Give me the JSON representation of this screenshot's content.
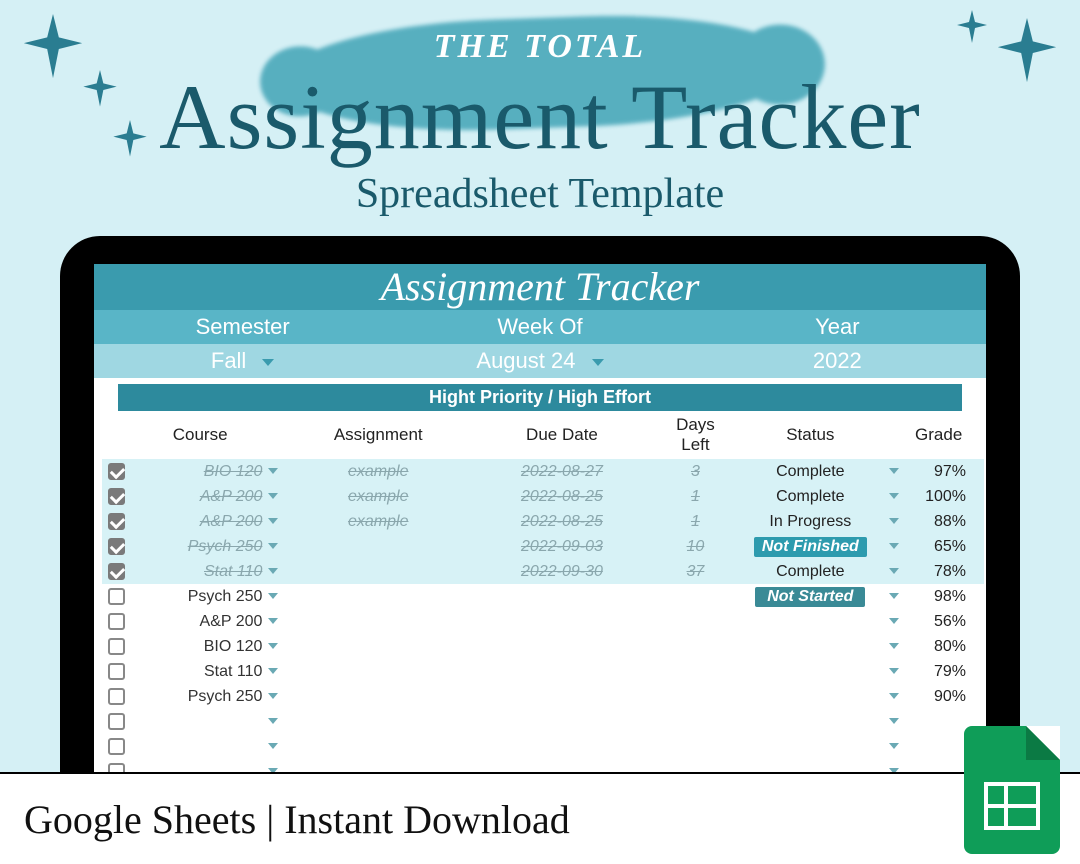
{
  "hero": {
    "eyebrow": "THE TOTAL",
    "title": "Assignment Tracker",
    "subtitle": "Spreadsheet Template"
  },
  "sheet": {
    "banner": "Assignment Tracker",
    "selectors": {
      "semester_label": "Semester",
      "semester_value": "Fall",
      "week_label": "Week Of",
      "week_value": "August 24",
      "year_label": "Year",
      "year_value": "2022"
    },
    "section_label": "Hight Priority / High Effort",
    "columns": {
      "course": "Course",
      "assignment": "Assignment",
      "due": "Due Date",
      "days": "Days Left",
      "status": "Status",
      "grade": "Grade"
    },
    "rows": [
      {
        "checked": true,
        "done": true,
        "course": "BIO 120",
        "assignment": "example",
        "due": "2022-08-27",
        "days": "3",
        "status": "Complete",
        "status_style": "plain",
        "grade": "97%"
      },
      {
        "checked": true,
        "done": true,
        "course": "A&P 200",
        "assignment": "example",
        "due": "2022-08-25",
        "days": "1",
        "status": "Complete",
        "status_style": "plain",
        "grade": "100%"
      },
      {
        "checked": true,
        "done": true,
        "course": "A&P 200",
        "assignment": "example",
        "due": "2022-08-25",
        "days": "1",
        "status": "In Progress",
        "status_style": "plain",
        "grade": "88%"
      },
      {
        "checked": true,
        "done": true,
        "course": "Psych 250",
        "assignment": "",
        "due": "2022-09-03",
        "days": "10",
        "status": "Not Finished",
        "status_style": "teal",
        "grade": "65%"
      },
      {
        "checked": true,
        "done": true,
        "course": "Stat 110",
        "assignment": "",
        "due": "2022-09-30",
        "days": "37",
        "status": "Complete",
        "status_style": "plain",
        "grade": "78%"
      },
      {
        "checked": false,
        "done": false,
        "course": "Psych 250",
        "assignment": "",
        "due": "",
        "days": "",
        "status": "Not Started",
        "status_style": "dark",
        "grade": "98%"
      },
      {
        "checked": false,
        "done": false,
        "course": "A&P 200",
        "assignment": "",
        "due": "",
        "days": "",
        "status": "",
        "status_style": "none",
        "grade": "56%"
      },
      {
        "checked": false,
        "done": false,
        "course": "BIO 120",
        "assignment": "",
        "due": "",
        "days": "",
        "status": "",
        "status_style": "none",
        "grade": "80%"
      },
      {
        "checked": false,
        "done": false,
        "course": "Stat 110",
        "assignment": "",
        "due": "",
        "days": "",
        "status": "",
        "status_style": "none",
        "grade": "79%"
      },
      {
        "checked": false,
        "done": false,
        "course": "Psych 250",
        "assignment": "",
        "due": "",
        "days": "",
        "status": "",
        "status_style": "none",
        "grade": "90%"
      },
      {
        "checked": false,
        "done": false,
        "course": "",
        "assignment": "",
        "due": "",
        "days": "",
        "status": "",
        "status_style": "none",
        "grade": ""
      },
      {
        "checked": false,
        "done": false,
        "course": "",
        "assignment": "",
        "due": "",
        "days": "",
        "status": "",
        "status_style": "none",
        "grade": ""
      },
      {
        "checked": false,
        "done": false,
        "course": "",
        "assignment": "",
        "due": "",
        "days": "",
        "status": "",
        "status_style": "none",
        "grade": ""
      }
    ]
  },
  "footer": {
    "text": "Google Sheets | Instant Download"
  }
}
